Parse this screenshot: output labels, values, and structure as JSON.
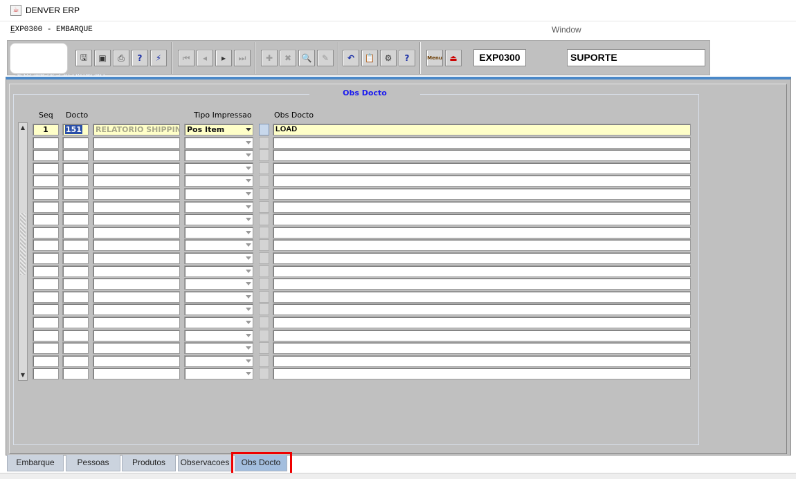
{
  "window": {
    "title": "DENVER ERP",
    "icon": "java-cup-icon"
  },
  "menubar": {
    "form_title_first": "E",
    "form_title_rest": "XP0300 - EMBARQUE",
    "window_menu": "Window"
  },
  "toolbar": {
    "buttons": [
      "save-icon",
      "window-icon",
      "print-icon",
      "query-help-icon",
      "execute-query-icon",
      "first-record-icon",
      "previous-record-icon",
      "next-record-icon",
      "last-record-icon",
      "insert-record-icon",
      "delete-record-icon",
      "search-icon",
      "edit-icon",
      "undo-icon",
      "clipboard-icon",
      "tools-icon",
      "help-icon",
      "menu-icon",
      "exit-icon"
    ],
    "form_code": "EXP0300",
    "user": "SUPORTE",
    "help_symbol": "?",
    "menu_label": "Menu"
  },
  "main": {
    "hidden_caption": "SISTEMA DE EXPORTACAO",
    "group_title": "Obs Docto",
    "columns": {
      "seq": "Seq",
      "docto": "Docto",
      "tipo": "Tipo Impressao",
      "obs": "Obs Docto"
    },
    "rows": [
      {
        "seq": "1",
        "docto": "151",
        "descricao": "RELATORIO SHIPPING S",
        "tipo": "Pos Item",
        "obs": "LOAD"
      },
      {
        "seq": "",
        "docto": "",
        "descricao": "",
        "tipo": "",
        "obs": ""
      },
      {
        "seq": "",
        "docto": "",
        "descricao": "",
        "tipo": "",
        "obs": ""
      },
      {
        "seq": "",
        "docto": "",
        "descricao": "",
        "tipo": "",
        "obs": ""
      },
      {
        "seq": "",
        "docto": "",
        "descricao": "",
        "tipo": "",
        "obs": ""
      },
      {
        "seq": "",
        "docto": "",
        "descricao": "",
        "tipo": "",
        "obs": ""
      },
      {
        "seq": "",
        "docto": "",
        "descricao": "",
        "tipo": "",
        "obs": ""
      },
      {
        "seq": "",
        "docto": "",
        "descricao": "",
        "tipo": "",
        "obs": ""
      },
      {
        "seq": "",
        "docto": "",
        "descricao": "",
        "tipo": "",
        "obs": ""
      },
      {
        "seq": "",
        "docto": "",
        "descricao": "",
        "tipo": "",
        "obs": ""
      },
      {
        "seq": "",
        "docto": "",
        "descricao": "",
        "tipo": "",
        "obs": ""
      },
      {
        "seq": "",
        "docto": "",
        "descricao": "",
        "tipo": "",
        "obs": ""
      },
      {
        "seq": "",
        "docto": "",
        "descricao": "",
        "tipo": "",
        "obs": ""
      },
      {
        "seq": "",
        "docto": "",
        "descricao": "",
        "tipo": "",
        "obs": ""
      },
      {
        "seq": "",
        "docto": "",
        "descricao": "",
        "tipo": "",
        "obs": ""
      },
      {
        "seq": "",
        "docto": "",
        "descricao": "",
        "tipo": "",
        "obs": ""
      },
      {
        "seq": "",
        "docto": "",
        "descricao": "",
        "tipo": "",
        "obs": ""
      },
      {
        "seq": "",
        "docto": "",
        "descricao": "",
        "tipo": "",
        "obs": ""
      },
      {
        "seq": "",
        "docto": "",
        "descricao": "",
        "tipo": "",
        "obs": ""
      },
      {
        "seq": "",
        "docto": "",
        "descricao": "",
        "tipo": "",
        "obs": ""
      }
    ]
  },
  "tabs": [
    {
      "label": "Embarque",
      "active": false
    },
    {
      "label": "Pessoas",
      "active": false
    },
    {
      "label": "Produtos",
      "active": false
    },
    {
      "label": "Observacoes",
      "active": false
    },
    {
      "label": "Obs Docto",
      "active": true
    }
  ],
  "colors": {
    "accent": "#4a88c8",
    "selected_row": "#ffffc8",
    "highlight_box": "#ee0000",
    "group_title": "#1a1af0"
  }
}
